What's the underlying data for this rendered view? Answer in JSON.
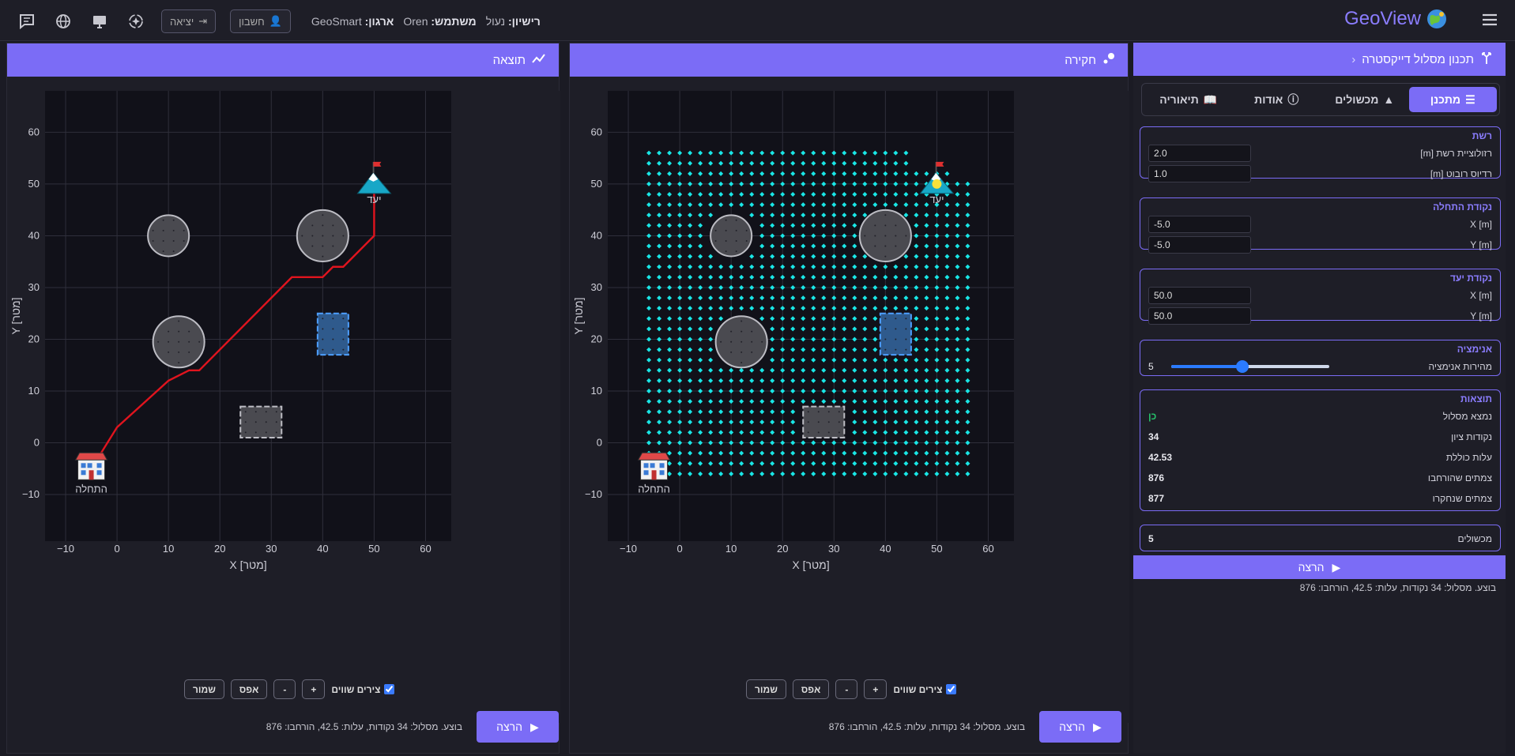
{
  "header": {
    "logo": "GeoView",
    "org_label": "ארגון:",
    "org_value": "GeoSmart",
    "user_label": "משתמש:",
    "user_value": "Oren",
    "license_label": "רישיון:",
    "license_value": "נעול",
    "account_btn": "חשבון",
    "logout_btn": "יציאה"
  },
  "result_panel": {
    "title": "תוצאה",
    "controls": {
      "equal_axes": "צירים שווים",
      "zoom_in": "+",
      "zoom_out": "-",
      "reset": "אפס",
      "save": "שמור"
    },
    "run": "הרצה",
    "status": "בוצע. מסלול: 34 נקודות, עלות: 42.5, הורחבו: 876"
  },
  "explore_panel": {
    "title": "חקירה",
    "controls": {
      "equal_axes": "צירים שווים",
      "zoom_in": "+",
      "zoom_out": "-",
      "reset": "אפס",
      "save": "שמור"
    },
    "run": "הרצה",
    "status": "בוצע. מסלול: 34 נקודות, עלות: 42.5, הורחבו: 876"
  },
  "sidebar": {
    "title": "תכנון מסלול דייקסטרה",
    "tabs": [
      {
        "label": "מתכנן",
        "icon": "sliders-icon"
      },
      {
        "label": "מכשולים",
        "icon": "shapes-icon"
      },
      {
        "label": "אודות",
        "icon": "info-icon"
      },
      {
        "label": "תיאוריה",
        "icon": "book-icon"
      }
    ],
    "grid": {
      "title": "רשת",
      "resolution_label": "רזולוציית רשת [m]",
      "resolution_value": "2.0",
      "robot_radius_label": "רדיוס רובוט [m]",
      "robot_radius_value": "1.0"
    },
    "start": {
      "title": "נקודת התחלה",
      "x_label": "X [m]",
      "x_value": "-5.0",
      "y_label": "Y [m]",
      "y_value": "-5.0"
    },
    "goal": {
      "title": "נקודת יעד",
      "x_label": "X [m]",
      "x_value": "50.0",
      "y_label": "Y [m]",
      "y_value": "50.0"
    },
    "animation": {
      "title": "אנימציה",
      "speed_label": "מהירות אנימציה",
      "speed_value": "5",
      "speed_fraction": 0.45
    },
    "results": {
      "title": "תוצאות",
      "path_found_label": "נמצא מסלול",
      "path_found_value": "כן",
      "points_label": "נקודות ציון",
      "points_value": "34",
      "cost_label": "עלות כוללת",
      "cost_value": "42.53",
      "expanded_label": "צמתים שהורחבו",
      "expanded_value": "876",
      "explored_label": "צמתים שנחקרו",
      "explored_value": "877"
    },
    "obstacles": {
      "label": "מכשולים",
      "value": "5"
    },
    "run": "הרצה",
    "status": "בוצע. מסלול: 34 נקודות, עלות: 42.5, הורחבו: 876"
  },
  "chart_data": [
    {
      "type": "scatter",
      "name": "result",
      "xlabel": "X [מטר]",
      "ylabel": "Y [מטר]",
      "xlim": [
        -14,
        65
      ],
      "ylim": [
        -19,
        68
      ],
      "x_ticks": [
        -10,
        0,
        10,
        20,
        30,
        40,
        50,
        60
      ],
      "y_ticks": [
        -10,
        0,
        10,
        20,
        30,
        40,
        50,
        60
      ],
      "grid": true,
      "start": {
        "x": -5,
        "y": -5,
        "label": "התחלה"
      },
      "goal": {
        "x": 50,
        "y": 50,
        "label": "יעד"
      },
      "obstacles": [
        {
          "shape": "circle",
          "x": 10,
          "y": 40,
          "r": 4
        },
        {
          "shape": "circle",
          "x": 40,
          "y": 40,
          "r": 5
        },
        {
          "shape": "circle",
          "x": 12,
          "y": 19.5,
          "r": 5
        },
        {
          "shape": "rect",
          "x1": 39,
          "y1": 17,
          "x2": 45,
          "y2": 25,
          "color": "blue"
        },
        {
          "shape": "rect",
          "x1": 24,
          "y1": 1,
          "x2": 32,
          "y2": 7
        }
      ],
      "path": [
        [
          -5,
          -5
        ],
        [
          0,
          3
        ],
        [
          10,
          12
        ],
        [
          14,
          14
        ],
        [
          16,
          14
        ],
        [
          34,
          32
        ],
        [
          40,
          32
        ],
        [
          42,
          34
        ],
        [
          44,
          34
        ],
        [
          50,
          40
        ],
        [
          50,
          50
        ]
      ]
    },
    {
      "type": "scatter",
      "name": "explore",
      "xlabel": "X [מטר]",
      "ylabel": "Y [מטר]",
      "xlim": [
        -14,
        65
      ],
      "ylim": [
        -19,
        68
      ],
      "x_ticks": [
        -10,
        0,
        10,
        20,
        30,
        40,
        50,
        60
      ],
      "y_ticks": [
        -10,
        0,
        10,
        20,
        30,
        40,
        50,
        60
      ],
      "grid": true,
      "start": {
        "x": -5,
        "y": -5,
        "label": "התחלה"
      },
      "goal": {
        "x": 50,
        "y": 50,
        "label": "יעד"
      },
      "explored": {
        "x_range": [
          -6,
          56
        ],
        "y_range": [
          -6,
          56
        ],
        "step": 2,
        "color": "#19e6e6"
      },
      "obstacles": [
        {
          "shape": "circle",
          "x": 10,
          "y": 40,
          "r": 4
        },
        {
          "shape": "circle",
          "x": 40,
          "y": 40,
          "r": 5
        },
        {
          "shape": "circle",
          "x": 12,
          "y": 19.5,
          "r": 5
        },
        {
          "shape": "rect",
          "x1": 39,
          "y1": 17,
          "x2": 45,
          "y2": 25,
          "color": "blue"
        },
        {
          "shape": "rect",
          "x1": 24,
          "y1": 1,
          "x2": 32,
          "y2": 7
        }
      ]
    }
  ]
}
